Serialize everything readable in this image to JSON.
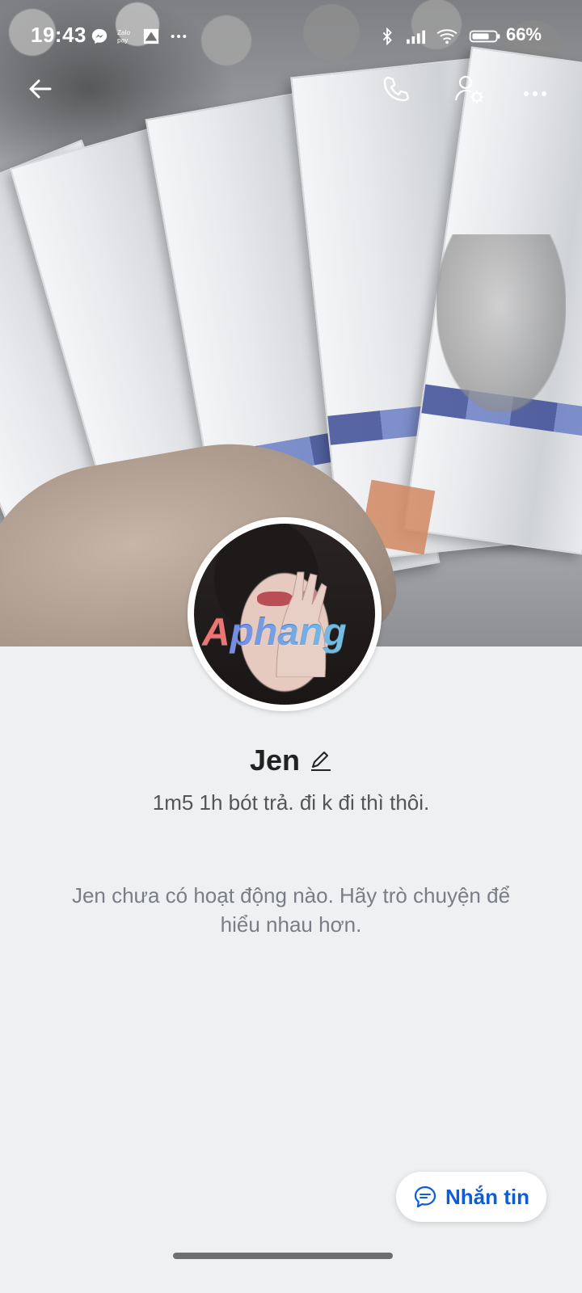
{
  "status_bar": {
    "time": "19:43",
    "battery_percent": "66%",
    "icons": [
      "messenger-icon",
      "zalopay-icon",
      "app-icon",
      "more-dots-icon",
      "bluetooth-icon",
      "signal-icon",
      "wifi-icon",
      "battery-icon"
    ]
  },
  "toolbar": {
    "back_icon": "back-arrow-icon",
    "call_icon": "phone-icon",
    "settings_icon": "user-settings-icon",
    "more_icon": "more-horizontal-icon"
  },
  "profile": {
    "name": "Jen",
    "edit_icon": "pencil-icon",
    "status": "1m5 1h bót trả. đi k đi thì thôi.",
    "avatar_watermark": "Aphang"
  },
  "empty_state": {
    "text": "Jen chưa có hoạt động nào. Hãy trò chuyện để hiểu nhau hơn."
  },
  "actions": {
    "message_label": "Nhắn tin",
    "message_icon": "chat-bubble-icon"
  },
  "colors": {
    "accent": "#0b5ed7",
    "background": "#eef0f2"
  }
}
